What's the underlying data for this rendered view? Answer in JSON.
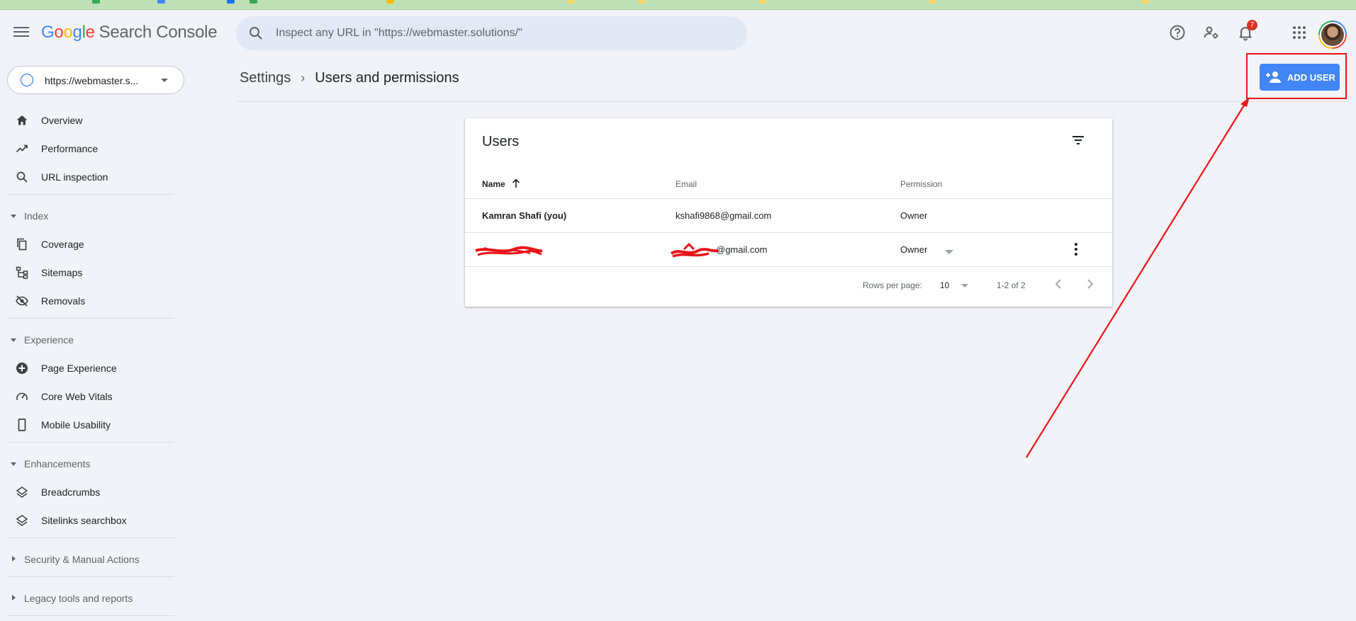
{
  "app": {
    "logo_letters": [
      "G",
      "o",
      "o",
      "g",
      "l",
      "e"
    ],
    "product_name": "Search Console"
  },
  "search": {
    "placeholder": "Inspect any URL in \"https://webmaster.solutions/\"",
    "value": ""
  },
  "header": {
    "notifications_count": "7",
    "icons": [
      "help-icon",
      "manage-users-icon",
      "notifications-icon",
      "apps-grid-icon"
    ]
  },
  "property": {
    "label": "https://webmaster.s..."
  },
  "sidebar": {
    "items": [
      {
        "label": "Overview",
        "icon": "home-icon"
      },
      {
        "label": "Performance",
        "icon": "trending-up-icon"
      },
      {
        "label": "URL inspection",
        "icon": "search-icon"
      }
    ],
    "index": {
      "label": "Index",
      "items": [
        {
          "label": "Coverage",
          "icon": "copy-icon"
        },
        {
          "label": "Sitemaps",
          "icon": "sitemap-icon"
        },
        {
          "label": "Removals",
          "icon": "eye-off-icon"
        }
      ]
    },
    "experience": {
      "label": "Experience",
      "items": [
        {
          "label": "Page Experience",
          "icon": "plus-circle-icon"
        },
        {
          "label": "Core Web Vitals",
          "icon": "speedometer-icon"
        },
        {
          "label": "Mobile Usability",
          "icon": "smartphone-icon"
        }
      ]
    },
    "enhancements": {
      "label": "Enhancements",
      "items": [
        {
          "label": "Breadcrumbs",
          "icon": "layers-icon"
        },
        {
          "label": "Sitelinks searchbox",
          "icon": "layers-icon"
        }
      ]
    },
    "security": {
      "label": "Security & Manual Actions"
    },
    "legacy": {
      "label": "Legacy tools and reports"
    }
  },
  "breadcrumb": {
    "parent": "Settings",
    "current": "Users and permissions"
  },
  "toolbar": {
    "add_user_label": "ADD USER"
  },
  "users_table": {
    "title": "Users",
    "columns": {
      "name": "Name",
      "email": "Email",
      "permission": "Permission"
    },
    "rows": [
      {
        "name": "Kamran Shafi (you)",
        "email": "kshafi9868@gmail.com",
        "permission": "Owner"
      },
      {
        "name": "",
        "email": "@gmail.com",
        "permission": "Owner"
      }
    ],
    "footer": {
      "rows_per_page_label": "Rows per page:",
      "rows_per_page_value": "10",
      "range": "1-2 of 2"
    }
  },
  "colors": {
    "accent": "#4285f4",
    "annotation": "#e8141a",
    "background": "#f1f3f8"
  }
}
